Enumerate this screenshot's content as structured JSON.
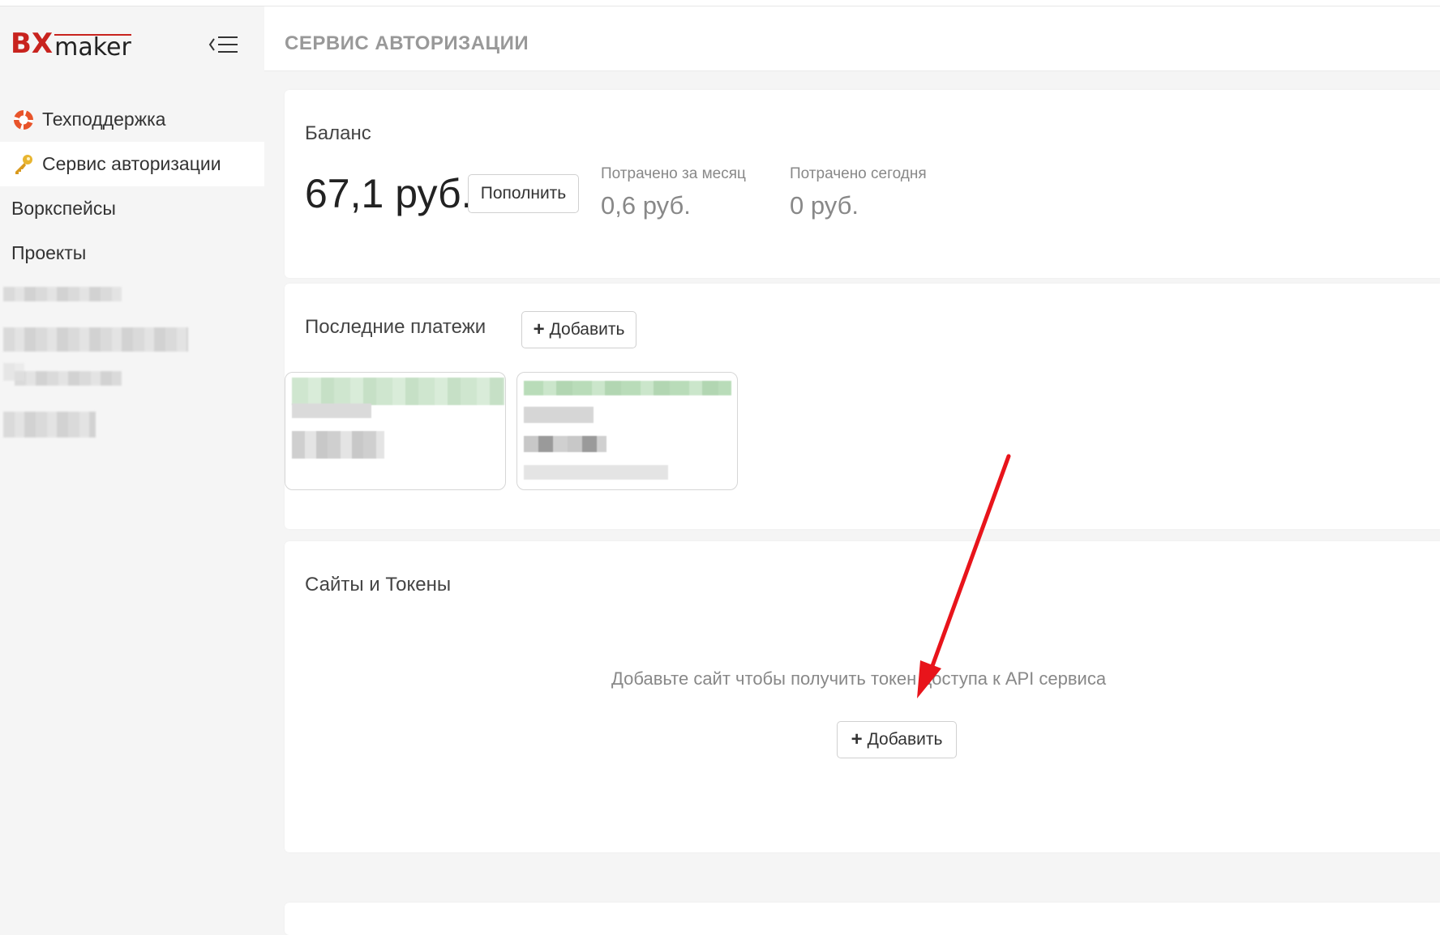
{
  "app": {
    "logo_text_bx": "BX",
    "logo_text_maker": "maker"
  },
  "sidebar": {
    "items": [
      {
        "label": "Техподдержка",
        "icon": "lifebuoy-icon",
        "active": false
      },
      {
        "label": "Сервис авторизации",
        "icon": "key-icon",
        "active": true
      },
      {
        "label": "Воркспейсы",
        "icon": "",
        "active": false
      },
      {
        "label": "Проекты",
        "icon": "",
        "active": false
      }
    ]
  },
  "header": {
    "title": "СЕРВИС АВТОРИЗАЦИИ"
  },
  "balance": {
    "title": "Баланс",
    "value": "67,1 руб.",
    "topup_label": "Пополнить",
    "spent_month_label": "Потрачено за месяц",
    "spent_month_value": "0,6 руб.",
    "spent_today_label": "Потрачено сегодня",
    "spent_today_value": "0 руб."
  },
  "payments": {
    "title": "Последние платежи",
    "add_label": "Добавить"
  },
  "sites": {
    "title": "Сайты и Токены",
    "empty_text": "Добавьте сайт чтобы получить токен доступа к API сервиса",
    "add_label": "Добавить"
  },
  "colors": {
    "brand_red": "#c8231e",
    "annotation_arrow": "#e8141b"
  }
}
